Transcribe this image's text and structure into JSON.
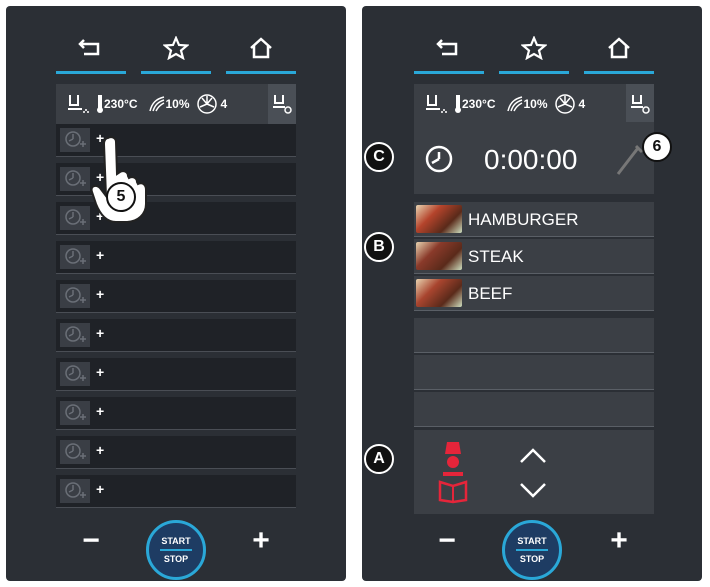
{
  "status_bar": {
    "temperature": "230°C",
    "humidity": "10%",
    "fan_speed": "4"
  },
  "left": {
    "slot_plus": "+",
    "slots": [
      "+",
      "+",
      "+",
      "+",
      "+",
      "+",
      "+",
      "+",
      "+",
      "+"
    ],
    "callout": "5"
  },
  "right": {
    "timer": "0:00:00",
    "recipes": [
      {
        "name": "HAMBURGER"
      },
      {
        "name": "STEAK"
      },
      {
        "name": "BEEF"
      }
    ],
    "callouts": {
      "a": "A",
      "b": "B",
      "c": "C",
      "six": "6"
    }
  },
  "controls": {
    "minus": "−",
    "plus": "+",
    "start": "START",
    "stop": "STOP"
  },
  "colors": {
    "accent": "#2aa8d8",
    "panel": "#2b2f35",
    "alert": "#e5253a"
  },
  "icons": [
    "back-icon",
    "star-icon",
    "home-icon",
    "tray-icon",
    "thermometer-icon",
    "humidity-icon",
    "fan-icon",
    "clock-icon",
    "probe-icon",
    "chevron-up-icon",
    "chevron-down-icon",
    "hand-pointer-icon"
  ]
}
